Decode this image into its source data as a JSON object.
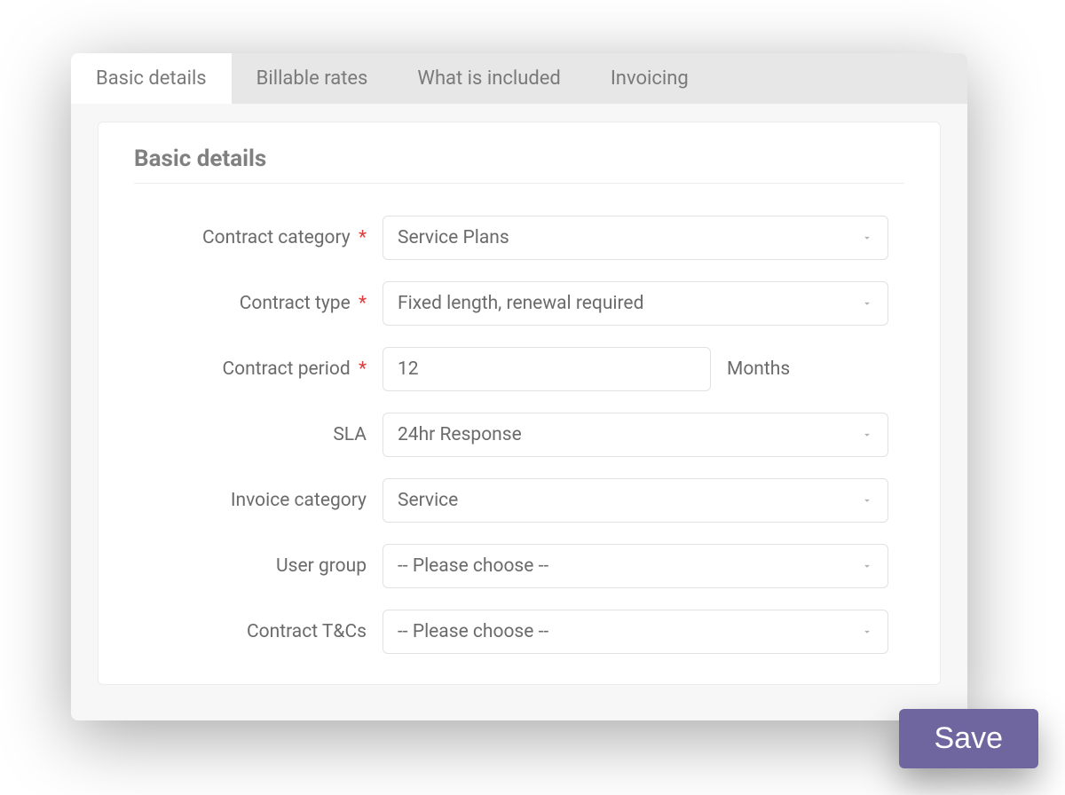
{
  "tabs": [
    {
      "label": "Basic details",
      "active": true
    },
    {
      "label": "Billable rates",
      "active": false
    },
    {
      "label": "What is included",
      "active": false
    },
    {
      "label": "Invoicing",
      "active": false
    }
  ],
  "section_title": "Basic details",
  "fields": {
    "contract_category": {
      "label": "Contract category",
      "required": true,
      "value": "Service Plans"
    },
    "contract_type": {
      "label": "Contract type",
      "required": true,
      "value": "Fixed length, renewal required"
    },
    "contract_period": {
      "label": "Contract period",
      "required": true,
      "value": "12",
      "suffix": "Months"
    },
    "sla": {
      "label": "SLA",
      "required": false,
      "value": "24hr Response"
    },
    "invoice_category": {
      "label": "Invoice category",
      "required": false,
      "value": "Service"
    },
    "user_group": {
      "label": "User group",
      "required": false,
      "value": "-- Please choose --"
    },
    "contract_tcs": {
      "label": "Contract T&Cs",
      "required": false,
      "value": "-- Please choose --"
    }
  },
  "required_marker": "*",
  "save_label": "Save"
}
